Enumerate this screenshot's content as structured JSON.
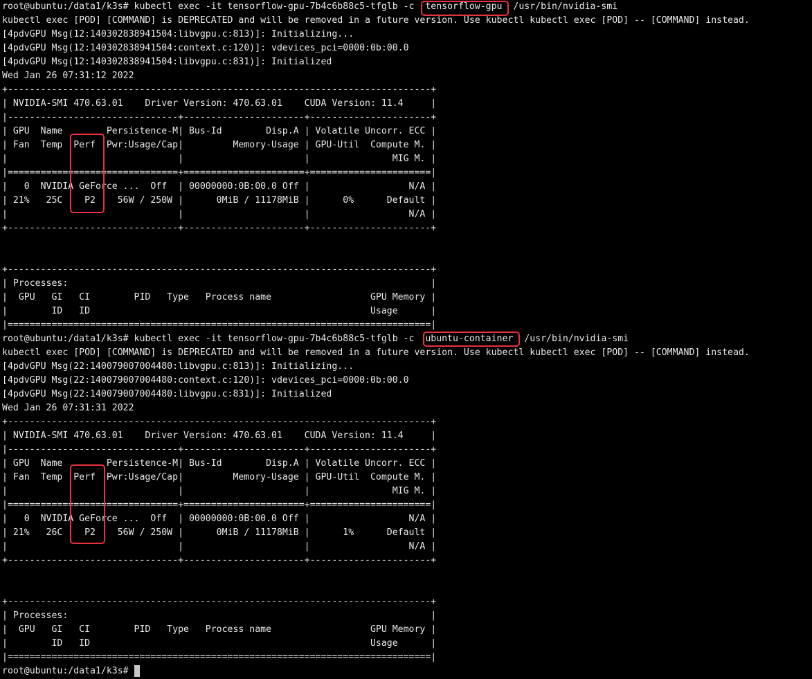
{
  "theme": {
    "background": "#000000",
    "text": "#e8e8e8",
    "highlight": "#e8323c",
    "cursor": "#c8c8c8"
  },
  "lines": [
    "root@ubuntu:/data1/k3s# kubectl exec -it tensorflow-gpu-7b4c6b88c5-tfglb -c  tensorflow-gpu  /usr/bin/nvidia-smi",
    "kubectl exec [POD] [COMMAND] is DEPRECATED and will be removed in a future version. Use kubectl kubectl exec [POD] -- [COMMAND] instead.",
    "[4pdvGPU Msg(12:140302838941504:libvgpu.c:813)]: Initializing...",
    "[4pdvGPU Msg(12:140302838941504:context.c:120)]: vdevices_pci=0000:0b:00.0",
    "[4pdvGPU Msg(12:140302838941504:libvgpu.c:831)]: Initialized",
    "Wed Jan 26 07:31:12 2022",
    "+-----------------------------------------------------------------------------+",
    "| NVIDIA-SMI 470.63.01    Driver Version: 470.63.01    CUDA Version: 11.4     |",
    "|-------------------------------+----------------------+----------------------+",
    "| GPU  Name        Persistence-M| Bus-Id        Disp.A | Volatile Uncorr. ECC |",
    "| Fan  Temp  Perf  Pwr:Usage/Cap|         Memory-Usage | GPU-Util  Compute M. |",
    "|                               |                      |               MIG M. |",
    "|===============================+======================+======================|",
    "|   0  NVIDIA GeForce ...  Off  | 00000000:0B:00.0 Off |                  N/A |",
    "| 21%   25C    P2    56W / 250W |      0MiB / 11178MiB |      0%      Default |",
    "|                               |                      |                  N/A |",
    "+-------------------------------+----------------------+----------------------+",
    "",
    "",
    "+-----------------------------------------------------------------------------+",
    "| Processes:                                                                  |",
    "|  GPU   GI   CI        PID   Type   Process name                  GPU Memory |",
    "|        ID   ID                                                   Usage      |",
    "|=============================================================================|",
    "root@ubuntu:/data1/k3s# kubectl exec -it tensorflow-gpu-7b4c6b88c5-tfglb -c  ubuntu-container  /usr/bin/nvidia-smi",
    "kubectl exec [POD] [COMMAND] is DEPRECATED and will be removed in a future version. Use kubectl kubectl exec [POD] -- [COMMAND] instead.",
    "[4pdvGPU Msg(22:140079007004480:libvgpu.c:813)]: Initializing...",
    "[4pdvGPU Msg(22:140079007004480:context.c:120)]: vdevices_pci=0000:0b:00.0",
    "[4pdvGPU Msg(22:140079007004480:libvgpu.c:831)]: Initialized",
    "Wed Jan 26 07:31:31 2022",
    "+-----------------------------------------------------------------------------+",
    "| NVIDIA-SMI 470.63.01    Driver Version: 470.63.01    CUDA Version: 11.4     |",
    "|-------------------------------+----------------------+----------------------+",
    "| GPU  Name        Persistence-M| Bus-Id        Disp.A | Volatile Uncorr. ECC |",
    "| Fan  Temp  Perf  Pwr:Usage/Cap|         Memory-Usage | GPU-Util  Compute M. |",
    "|                               |                      |               MIG M. |",
    "|===============================+======================+======================|",
    "|   0  NVIDIA GeForce ...  Off  | 00000000:0B:00.0 Off |                  N/A |",
    "| 21%   26C    P2    56W / 250W |      0MiB / 11178MiB |      1%      Default |",
    "|                               |                      |                  N/A |",
    "+-------------------------------+----------------------+----------------------+",
    "",
    "",
    "+-----------------------------------------------------------------------------+",
    "| Processes:                                                                  |",
    "|  GPU   GI   CI        PID   Type   Process name                  GPU Memory |",
    "|        ID   ID                                                   Usage      |",
    "|=============================================================================|",
    "root@ubuntu:/data1/k3s# "
  ]
}
